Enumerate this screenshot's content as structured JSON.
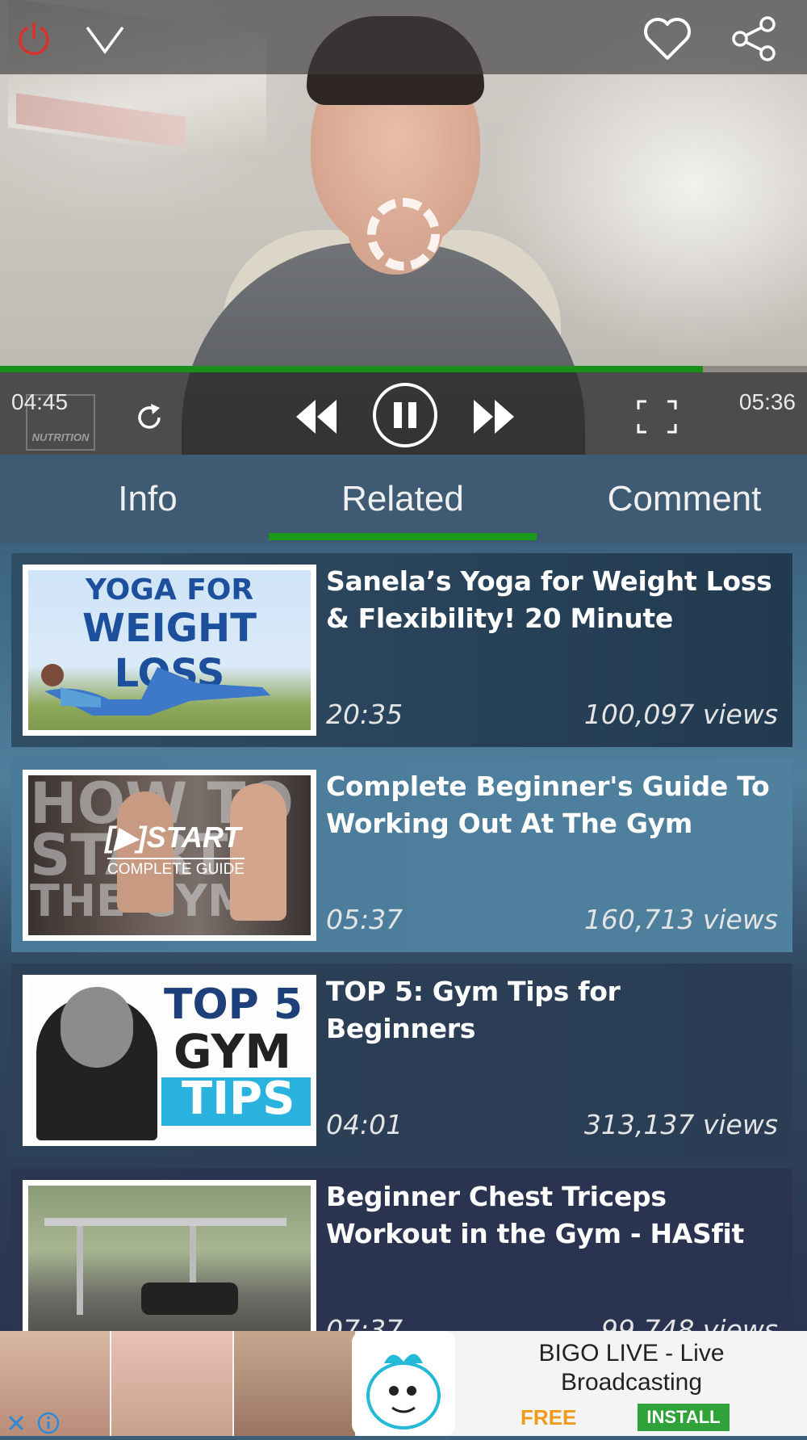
{
  "player": {
    "current_time": "04:45",
    "total_time": "05:36",
    "progress": 0.8705,
    "watermark_text": "NUTRITION"
  },
  "icons": {
    "power": "power-icon",
    "collapse": "chevron-down-icon",
    "favorite": "heart-icon",
    "share": "share-icon",
    "replay": "replay-icon",
    "rewind": "rewind-icon",
    "pause": "pause-icon",
    "forward": "fast-forward-icon",
    "fullscreen": "fullscreen-icon",
    "ad_close": "close-icon",
    "ad_info": "info-icon"
  },
  "tabs": [
    {
      "label": "Info"
    },
    {
      "label": "Related"
    },
    {
      "label": "Comment"
    }
  ],
  "related": [
    {
      "title": "Sanela’s Yoga for Weight Loss & Flexibility! 20 Minute",
      "duration": "20:35",
      "views": "100,097 views",
      "thumb_text": [
        "YOGA FOR",
        "WEIGHT LOSS"
      ]
    },
    {
      "title": "Complete Beginner's Guide To Working Out At The Gym",
      "duration": "05:37",
      "views": "160,713 views",
      "thumb_text": [
        "HOW TO",
        "START",
        "THE GYM",
        "[▶]START",
        "COMPLETE GUIDE"
      ]
    },
    {
      "title": "TOP 5: Gym Tips for Beginners",
      "duration": "04:01",
      "views": "313,137 views",
      "thumb_text": [
        "TOP 5",
        "GYM",
        "TIPS"
      ]
    },
    {
      "title": "Beginner Chest Triceps Workout in the Gym - HASfit",
      "duration": "07:37",
      "views": "99,748 views",
      "thumb_text": []
    }
  ],
  "ad": {
    "title": "BIGO LIVE - Live Broadcasting",
    "price": "FREE",
    "cta": "INSTALL"
  },
  "colors": {
    "accent_green": "#1a9a1a",
    "power_red": "#d9302e",
    "tab_bg": "#3e5b73",
    "ad_free": "#f09a1a",
    "ad_install": "#2fa33a"
  }
}
